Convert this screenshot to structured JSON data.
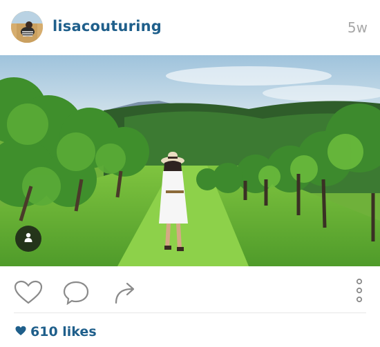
{
  "post": {
    "username": "lisacouturing",
    "age": "5w",
    "likes_label": "610 likes"
  },
  "icons": {
    "like": "heart-outline-icon",
    "comment": "comment-bubble-icon",
    "share": "share-arrow-icon",
    "more": "vertical-dots-icon",
    "likes": "heart-filled-icon",
    "user_tag": "person-icon"
  },
  "colors": {
    "username": "#1f5f8b",
    "age": "#a8a8a8",
    "icon_stroke": "#8a8a8a"
  }
}
